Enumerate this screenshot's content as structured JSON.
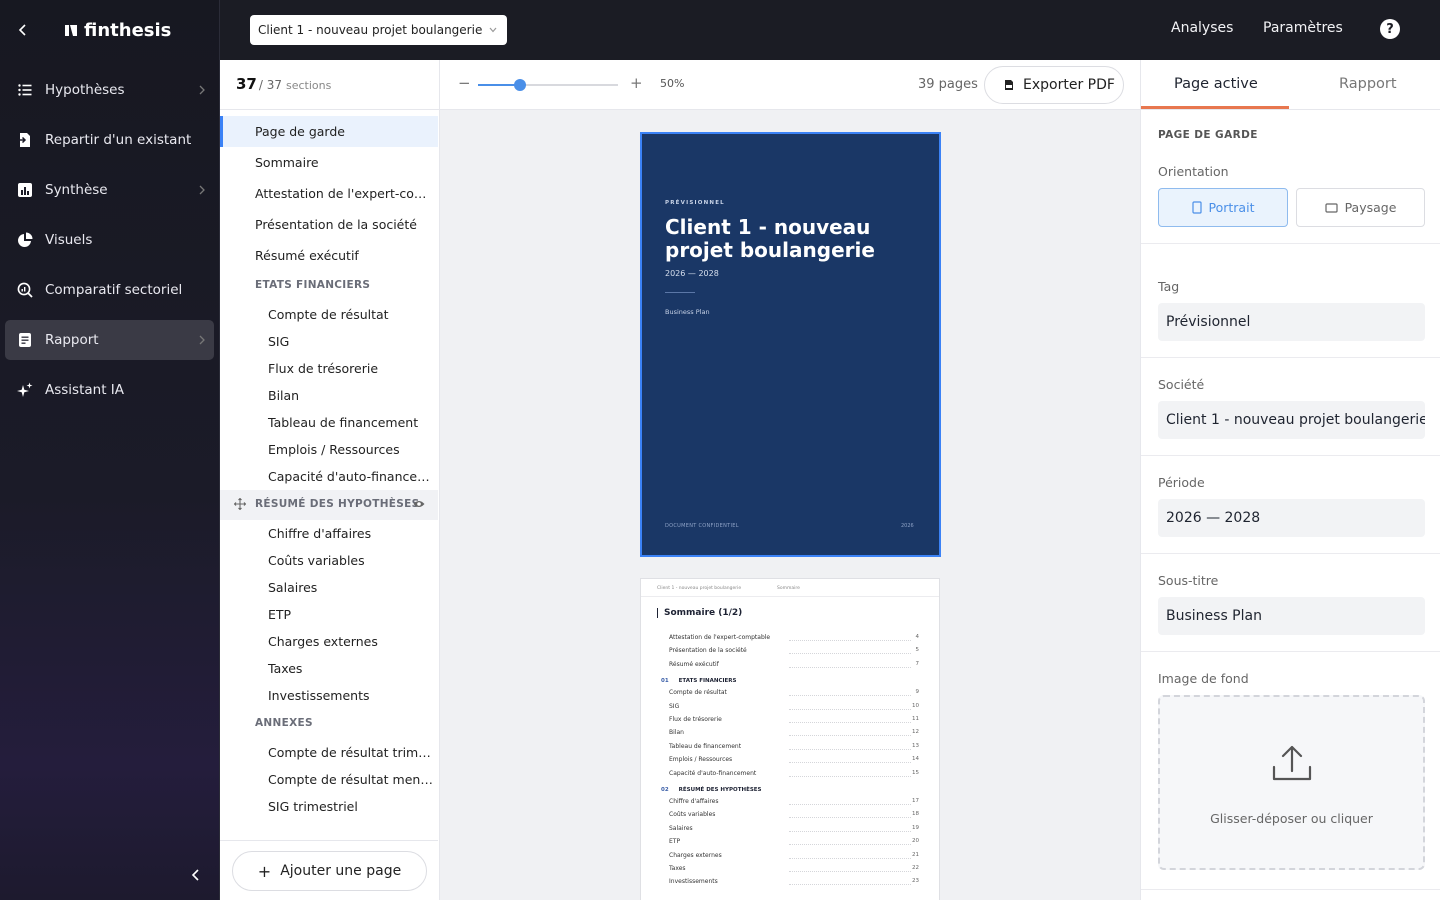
{
  "app": {
    "logo_text": "finthesis"
  },
  "sidebar": {
    "items": [
      {
        "label": "Hypothèses",
        "icon": "list-icon",
        "has_chevron": true
      },
      {
        "label": "Repartir d'un existant",
        "icon": "import-icon",
        "has_chevron": false
      },
      {
        "label": "Synthèse",
        "icon": "bar-chart-icon",
        "has_chevron": true
      },
      {
        "label": "Visuels",
        "icon": "pie-chart-icon",
        "has_chevron": false
      },
      {
        "label": "Comparatif sectoriel",
        "icon": "magnify-chart-icon",
        "has_chevron": false
      },
      {
        "label": "Rapport",
        "icon": "report-icon",
        "has_chevron": true,
        "active": true
      },
      {
        "label": "Assistant IA",
        "icon": "sparkle-icon",
        "has_chevron": false
      }
    ]
  },
  "topbar": {
    "client_select": "Client 1 - nouveau projet boulangerie",
    "links": [
      "Analyses",
      "Paramètres"
    ],
    "help": "?"
  },
  "sections": {
    "count": "37",
    "total": "/ 37",
    "word": "sections",
    "rows": [
      {
        "label": "Page de garde",
        "kind": "lvl0",
        "active": true
      },
      {
        "label": "Sommaire",
        "kind": "lvl0"
      },
      {
        "label": "Attestation de l'expert-comptable",
        "kind": "lvl0"
      },
      {
        "label": "Présentation de la société",
        "kind": "lvl0"
      },
      {
        "label": "Résumé exécutif",
        "kind": "lvl0"
      },
      {
        "label": "ETATS FINANCIERS",
        "kind": "group"
      },
      {
        "label": "Compte de résultat",
        "kind": "lvl1"
      },
      {
        "label": "SIG",
        "kind": "lvl1"
      },
      {
        "label": "Flux de trésorerie",
        "kind": "lvl1"
      },
      {
        "label": "Bilan",
        "kind": "lvl1"
      },
      {
        "label": "Tableau de financement",
        "kind": "lvl1"
      },
      {
        "label": "Emplois / Ressources",
        "kind": "lvl1"
      },
      {
        "label": "Capacité d'auto-financement",
        "kind": "lvl1"
      },
      {
        "label": "RÉSUMÉ DES HYPOTHÈSES",
        "kind": "group",
        "hovered": true
      },
      {
        "label": "Chiffre d'affaires",
        "kind": "lvl1"
      },
      {
        "label": "Coûts variables",
        "kind": "lvl1"
      },
      {
        "label": "Salaires",
        "kind": "lvl1"
      },
      {
        "label": "ETP",
        "kind": "lvl1"
      },
      {
        "label": "Charges externes",
        "kind": "lvl1"
      },
      {
        "label": "Taxes",
        "kind": "lvl1"
      },
      {
        "label": "Investissements",
        "kind": "lvl1"
      },
      {
        "label": "ANNEXES",
        "kind": "group"
      },
      {
        "label": "Compte de résultat trimestriel",
        "kind": "lvl1"
      },
      {
        "label": "Compte de résultat mensuel",
        "kind": "lvl1"
      },
      {
        "label": "SIG trimestriel",
        "kind": "lvl1"
      }
    ],
    "add_page_label": "Ajouter une page"
  },
  "preview": {
    "zoom_label": "50%",
    "zoom_fraction": 0.3,
    "pages_count": "39 pages",
    "export_label": "Exporter PDF",
    "cover": {
      "tag": "PRÉVISIONNEL",
      "title": "Client 1 - nouveau projet boulangerie",
      "period": "2026 — 2028",
      "subtitle": "Business Plan",
      "footer_left": "DOCUMENT CONFIDENTIEL",
      "footer_right": "2026",
      "background": "#1a3766"
    },
    "summary": {
      "header_client": "Client 1 - nouveau projet boulangerie",
      "header_section": "Sommaire",
      "title": "Sommaire (1/2)",
      "entries": [
        {
          "type": "row",
          "label": "Attestation de l'expert-comptable",
          "page": "4"
        },
        {
          "type": "row",
          "label": "Présentation de la société",
          "page": "5"
        },
        {
          "type": "row",
          "label": "Résumé exécutif",
          "page": "7"
        },
        {
          "type": "group",
          "num": "01",
          "label": "ETATS FINANCIERS"
        },
        {
          "type": "row",
          "label": "Compte de résultat",
          "page": "9"
        },
        {
          "type": "row",
          "label": "SIG",
          "page": "10"
        },
        {
          "type": "row",
          "label": "Flux de trésorerie",
          "page": "11"
        },
        {
          "type": "row",
          "label": "Bilan",
          "page": "12"
        },
        {
          "type": "row",
          "label": "Tableau de financement",
          "page": "13"
        },
        {
          "type": "row",
          "label": "Emplois / Ressources",
          "page": "14"
        },
        {
          "type": "row",
          "label": "Capacité d'auto-financement",
          "page": "15"
        },
        {
          "type": "group",
          "num": "02",
          "label": "RÉSUMÉ DES HYPOTHÈSES"
        },
        {
          "type": "row",
          "label": "Chiffre d'affaires",
          "page": "17"
        },
        {
          "type": "row",
          "label": "Coûts variables",
          "page": "18"
        },
        {
          "type": "row",
          "label": "Salaires",
          "page": "19"
        },
        {
          "type": "row",
          "label": "ETP",
          "page": "20"
        },
        {
          "type": "row",
          "label": "Charges externes",
          "page": "21"
        },
        {
          "type": "row",
          "label": "Taxes",
          "page": "22"
        },
        {
          "type": "row",
          "label": "Investissements",
          "page": "23"
        }
      ]
    }
  },
  "inspector": {
    "tabs": [
      "Page active",
      "Rapport"
    ],
    "section_title": "PAGE DE GARDE",
    "orientation_label": "Orientation",
    "orientation_options": [
      "Portrait",
      "Paysage"
    ],
    "tag_label": "Tag",
    "tag_value": "Prévisionnel",
    "company_label": "Société",
    "company_value": "Client 1 - nouveau projet boulangerie",
    "period_label": "Période",
    "period_value": "2026 — 2028",
    "subtitle_label": "Sous-titre",
    "subtitle_value": "Business Plan",
    "bg_label": "Image de fond",
    "dropzone_text": "Glisser-déposer ou cliquer"
  },
  "colors": {
    "accent": "#3b82f6",
    "tab_underline": "#e8774f",
    "sidebar_bg": "#171821",
    "cover_bg": "#1a3766"
  }
}
